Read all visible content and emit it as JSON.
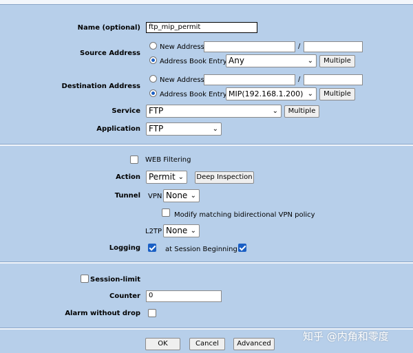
{
  "policy": {
    "name_label": "Name (optional)",
    "name_value": "ftp_mip_permit",
    "source": {
      "label": "Source Address",
      "new_address_label": "New Address",
      "address_book_label": "Address Book Entry",
      "slash": "/",
      "selected": "Any",
      "multiple": "Multiple",
      "mode": "address-book"
    },
    "destination": {
      "label": "Destination Address",
      "new_address_label": "New Address",
      "address_book_label": "Address Book Entry",
      "slash": "/",
      "selected": "MIP(192.168.1.200)",
      "multiple": "Multiple",
      "mode": "address-book"
    },
    "service": {
      "label": "Service",
      "selected": "FTP",
      "multiple": "Multiple"
    },
    "application": {
      "label": "Application",
      "selected": "FTP"
    }
  },
  "filtering": {
    "web_filtering_label": "WEB Filtering",
    "web_filtering_checked": false,
    "action_label": "Action",
    "action_selected": "Permit",
    "deep_inspection": "Deep Inspection",
    "tunnel_label": "Tunnel",
    "vpn_label": "VPN",
    "vpn_selected": "None",
    "modify_vpn_label": "Modify matching bidirectional VPN policy",
    "modify_vpn_checked": false,
    "l2tp_label": "L2TP",
    "l2tp_selected": "None",
    "logging_label": "Logging",
    "logging_checked": true,
    "session_begin_label": "at Session Beginning",
    "session_begin_checked": true
  },
  "limits": {
    "session_limit_label": "Session-limit",
    "session_limit_checked": false,
    "counter_label": "Counter",
    "counter_value": "0",
    "alarm_label": "Alarm without drop",
    "alarm_checked": false
  },
  "buttons": {
    "ok": "OK",
    "cancel": "Cancel",
    "advanced": "Advanced"
  },
  "watermark": "知乎 @内角和零度",
  "colors": {
    "background": "#b7cfea",
    "checkbox_on": "#1a5fc4"
  }
}
